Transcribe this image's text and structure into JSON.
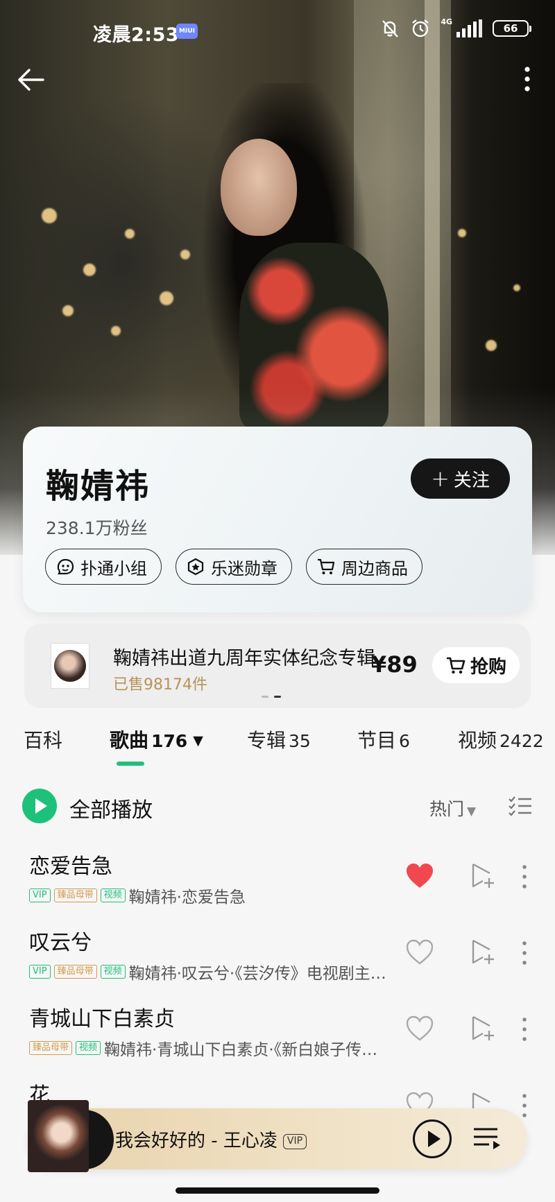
{
  "status_bar": {
    "time": "凌晨2:53",
    "miui_badge": "MIUI",
    "network": "4G",
    "battery": "66"
  },
  "artist": {
    "name": "鞠婧祎",
    "fans": "238.1万粉丝",
    "follow_label": "关注",
    "chips": [
      {
        "label": "扑通小组",
        "icon": "group-chat-icon"
      },
      {
        "label": "乐迷勋章",
        "icon": "medal-icon"
      },
      {
        "label": "周边商品",
        "icon": "cart-icon"
      }
    ]
  },
  "promo": {
    "title": "鞠婧祎出道九周年实体纪念专辑",
    "sold": "已售98174件",
    "price": "¥89",
    "buy_label": "抢购",
    "slides": 2,
    "active_slide": 2
  },
  "tabs": [
    {
      "label": "百科",
      "count": ""
    },
    {
      "label": "歌曲",
      "count": "176"
    },
    {
      "label": "专辑",
      "count": "35"
    },
    {
      "label": "节目",
      "count": "6"
    },
    {
      "label": "视频",
      "count": "2422"
    }
  ],
  "active_tab": "歌曲",
  "play_all": {
    "label": "全部播放",
    "sort_label": "热门"
  },
  "songs": [
    {
      "title": "恋爱告急",
      "badges": [
        "VIP",
        "臻品母带",
        "视频"
      ],
      "subtitle": "鞠婧祎·恋爱告急",
      "liked": true
    },
    {
      "title": "叹云兮",
      "badges": [
        "VIP",
        "臻品母带",
        "视频"
      ],
      "subtitle": "鞠婧祎·叹云兮·《芸汐传》电视剧主题曲",
      "liked": false
    },
    {
      "title": "青城山下白素贞",
      "badges": [
        "臻品母带",
        "视频"
      ],
      "subtitle": "鞠婧祎·青城山下白素贞·《新白娘子传奇》",
      "liked": false
    },
    {
      "title": "花",
      "badges": [],
      "subtitle": "",
      "liked": false
    }
  ],
  "now_playing": {
    "title": "我会好好的 - 王心凌",
    "badge": "VIP"
  },
  "colors": {
    "accent": "#1ec17a",
    "liked": "#f0484f",
    "gold": "#d39a4c"
  }
}
